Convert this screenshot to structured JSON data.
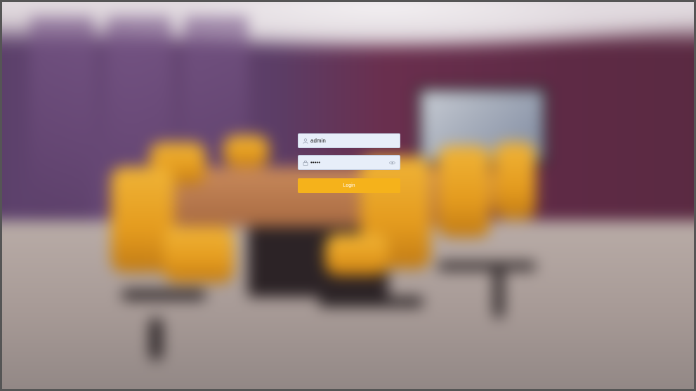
{
  "login": {
    "username_value": "admin",
    "password_value": "•••••",
    "login_label": "Login"
  },
  "icons": {
    "username": "user-icon",
    "password": "lock-icon",
    "reveal": "eye-icon"
  },
  "colors": {
    "accent": "#f5b21b",
    "field_bg": "#e7eef9"
  }
}
